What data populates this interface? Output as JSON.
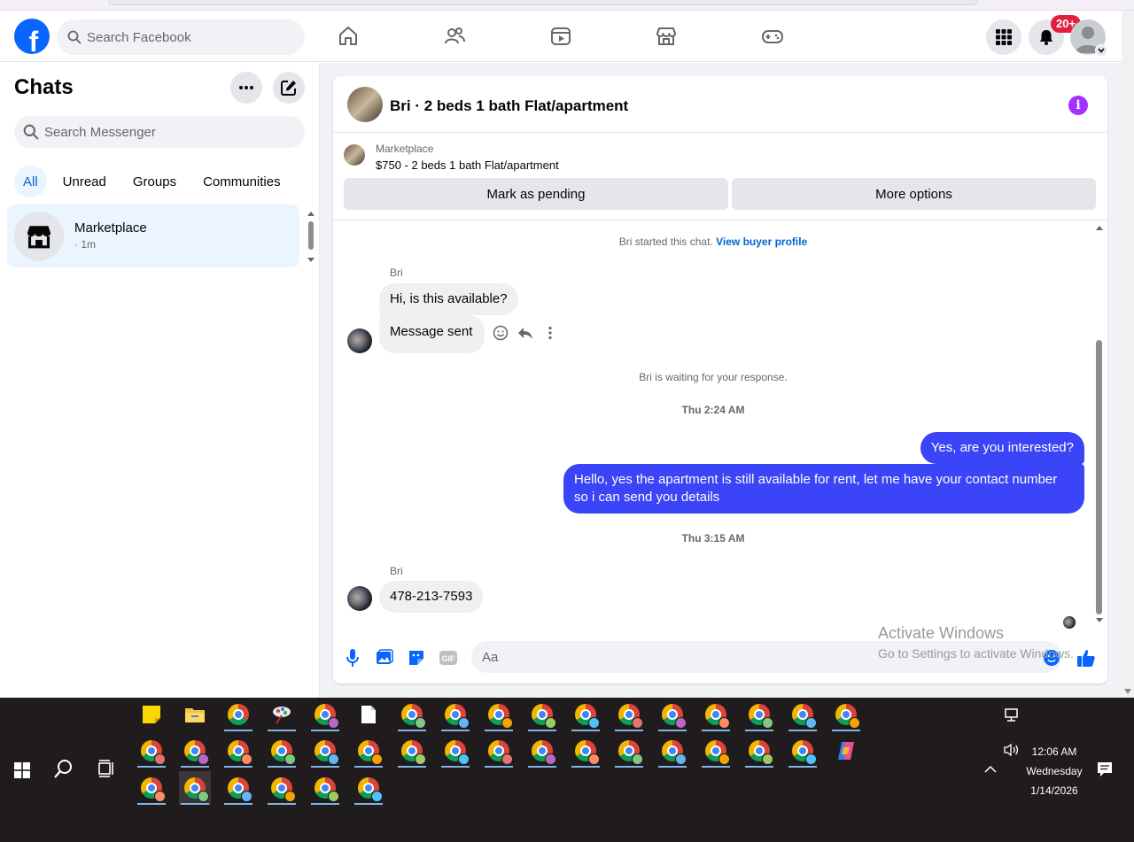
{
  "header": {
    "search_placeholder": "Search Facebook",
    "notification_badge": "20+",
    "logo_letter": "f"
  },
  "sidebar": {
    "title": "Chats",
    "search_placeholder": "Search Messenger",
    "filters": [
      "All",
      "Unread",
      "Groups",
      "Communities"
    ],
    "active_filter": "All",
    "chats": [
      {
        "name": "Marketplace",
        "time": "· 1m"
      }
    ]
  },
  "conversation": {
    "title": "Bri · 2 beds 1 bath Flat/apartment",
    "marketplace_label": "Marketplace",
    "listing": "$750 - 2 beds 1 bath Flat/apartment",
    "buttons": {
      "pending": "Mark as pending",
      "more": "More options"
    },
    "started_text": "Bri started this chat.",
    "profile_link": "View buyer profile",
    "messages": [
      {
        "from": "Bri",
        "text": "Hi, is this available?"
      },
      {
        "from": "Bri",
        "text": "Message sent"
      },
      {
        "system": "Bri is waiting for your response."
      },
      {
        "stamp": "Thu 2:24 AM"
      },
      {
        "from": "me",
        "text": "Yes, are you interested?"
      },
      {
        "from": "me",
        "text": "Hello, yes the apartment is still available for rent, let me have your contact number so i can send you details"
      },
      {
        "stamp": "Thu 3:15 AM"
      },
      {
        "from": "Bri",
        "text": "478-213-7593"
      }
    ],
    "composer_placeholder": "Aa",
    "gif_label": "GIF"
  },
  "watermark": {
    "title": "Activate Windows",
    "subtitle": "Go to Settings to activate Windows."
  },
  "taskbar": {
    "time": "12:06 AM",
    "day": "Wednesday",
    "date": "1/14/2026"
  },
  "colors": {
    "brand": "#0866ff",
    "outgoing": "#3b44f6",
    "badge": "#e41e3f",
    "info": "#a033ff"
  }
}
